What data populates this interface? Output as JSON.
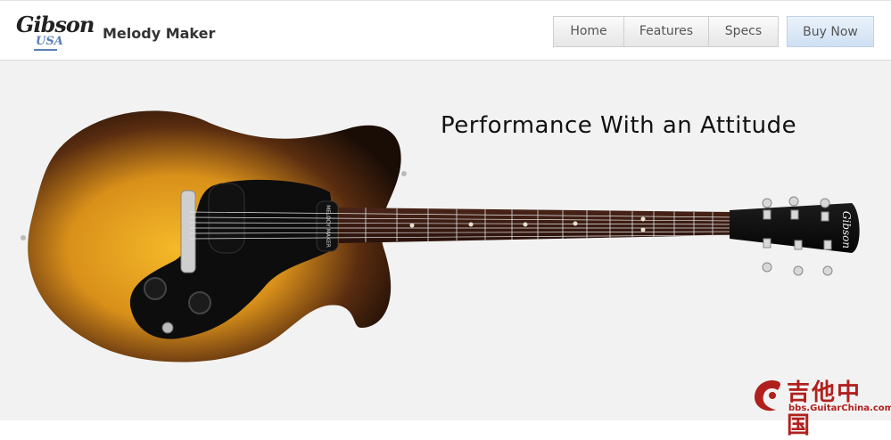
{
  "logo": {
    "script": "Gibson",
    "sub": "USA"
  },
  "header": {
    "title": "Melody Maker"
  },
  "nav": {
    "items": [
      {
        "label": "Home"
      },
      {
        "label": "Features"
      },
      {
        "label": "Specs"
      }
    ],
    "buy_label": "Buy Now"
  },
  "hero": {
    "tagline": "Performance With an Attitude",
    "pickguard_text": "MELODY MAKER",
    "headstock_text": "Gibson"
  },
  "watermark": {
    "text": "吉他中国",
    "sub": "bbs.GuitarChina.com"
  },
  "colors": {
    "accent": "#cfe0f3",
    "hero_bg": "#f2f2f2",
    "watermark": "#b0211e"
  }
}
